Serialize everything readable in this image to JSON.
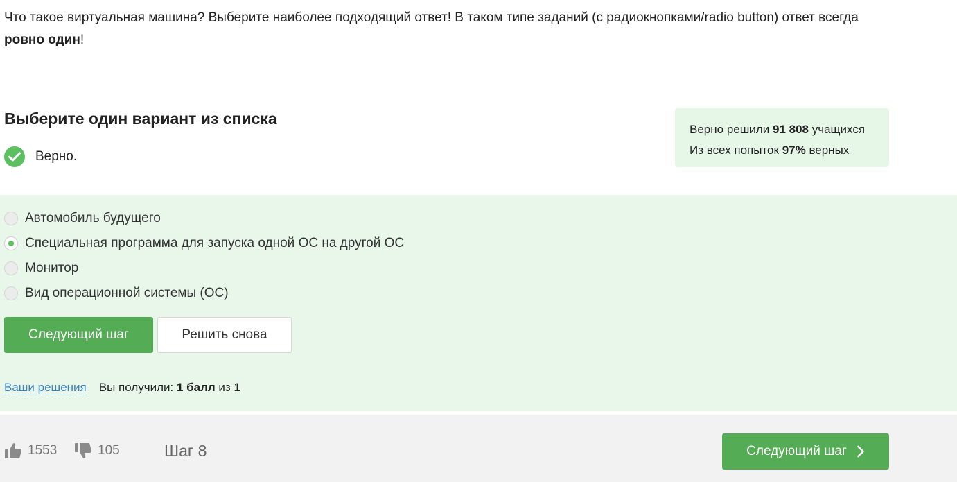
{
  "question": {
    "text_main": "Что такое виртуальная машина? Выберите наиболее подходящий ответ! В таком типе заданий (с радиокнопками/radio button) ответ всегда ",
    "text_bold": "ровно один",
    "text_end": "!"
  },
  "task": {
    "title": "Выберите один вариант из списка",
    "verdict": "Верно."
  },
  "stats": {
    "solved_prefix": "Верно решили ",
    "solved_count": "91 808",
    "solved_suffix": " учащихся",
    "attempts_prefix": "Из всех попыток ",
    "attempts_percent": "97%",
    "attempts_suffix": " верных"
  },
  "options": [
    {
      "label": "Автомобиль будущего",
      "checked": false
    },
    {
      "label": "Специальная программа для запуска одной ОС на другой ОС",
      "checked": true
    },
    {
      "label": "Монитор",
      "checked": false
    },
    {
      "label": "Вид операционной системы (ОС)",
      "checked": false
    }
  ],
  "actions": {
    "next_step": "Следующий шаг",
    "solve_again": "Решить снова"
  },
  "result": {
    "solutions_link": "Ваши решения",
    "score_prefix": "Вы получили: ",
    "score_value": "1 балл",
    "score_suffix": " из 1"
  },
  "footer": {
    "likes": "1553",
    "dislikes": "105",
    "step": "Шаг 8",
    "next_step": "Следующий шаг"
  },
  "colors": {
    "accent_green": "#54ad54",
    "success_bg": "#e8f7ea",
    "link_blue": "#3b82c4"
  },
  "icons": {
    "verdict": "check-circle-icon",
    "like": "thumbs-up-icon",
    "dislike": "thumbs-down-icon",
    "next": "chevron-right-icon"
  }
}
